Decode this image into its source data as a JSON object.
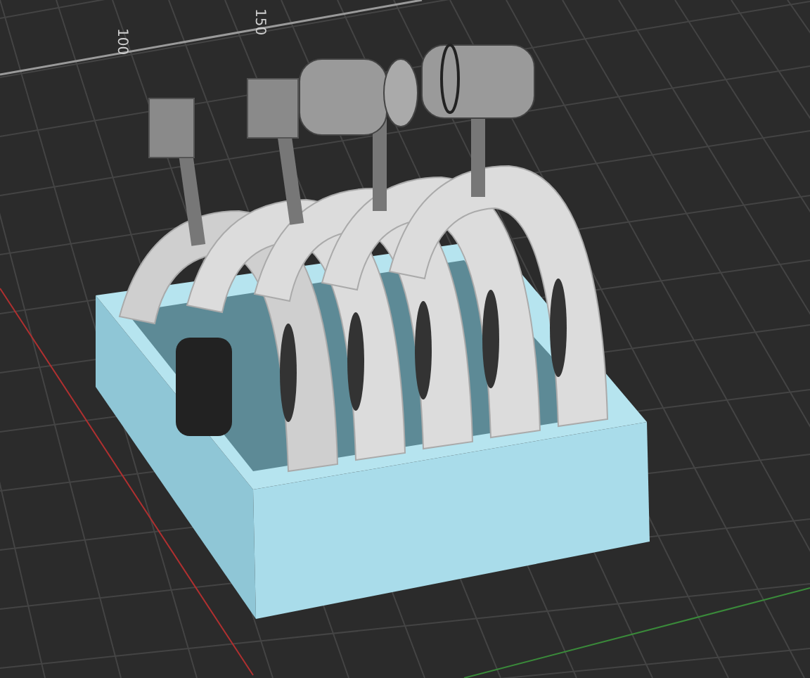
{
  "viewport": {
    "axis_labels": [
      {
        "text": "100"
      },
      {
        "text": "150"
      }
    ]
  }
}
